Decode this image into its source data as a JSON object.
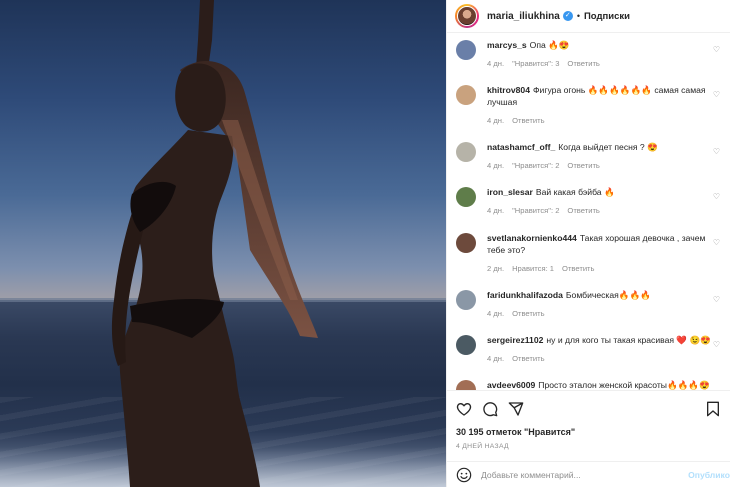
{
  "post": {
    "username": "maria_iliukhina",
    "verified_mark": "✓",
    "separator": "•",
    "follow_label": "Подписки",
    "likes_text": "30 195 отметок \"Нравится\"",
    "time_ago": "4 ДНЕЙ НАЗАД",
    "comment_placeholder": "Добавьте комментарий...",
    "post_button": "Опублико"
  },
  "comments": [
    {
      "user": "marcys_s",
      "text": "Опа 🔥😍",
      "time": "4 дн.",
      "likes": "\"Нравится\": 3",
      "reply": "Ответить",
      "avatar_color": "#6a7fa8"
    },
    {
      "user": "khitrov804",
      "text": "Фигура огонь 🔥🔥🔥🔥🔥🔥 самая самая лучшая",
      "time": "4 дн.",
      "likes": "",
      "reply": "Ответить",
      "avatar_color": "#c9a27e"
    },
    {
      "user": "natashamcf_off_",
      "text": "Когда выйдет песня ? 😍",
      "time": "4 дн.",
      "likes": "\"Нравится\": 2",
      "reply": "Ответить",
      "avatar_color": "#b6b3a8"
    },
    {
      "user": "iron_slesar",
      "text": "Вай какая бэйба 🔥",
      "time": "4 дн.",
      "likes": "\"Нравится\": 2",
      "reply": "Ответить",
      "avatar_color": "#5f7d4a"
    },
    {
      "user": "svetlanakornienko444",
      "text": "Такая хорошая девочка , зачем тебе это?",
      "time": "2 дн.",
      "likes": "Нравится: 1",
      "reply": "Ответить",
      "avatar_color": "#6d4a3c"
    },
    {
      "user": "faridunkhalifazoda",
      "text": "Бомбическая🔥🔥🔥",
      "time": "4 дн.",
      "likes": "",
      "reply": "Ответить",
      "avatar_color": "#8a97a6"
    },
    {
      "user": "sergeirez1102",
      "text": "ну и для кого ты такая красивая ❤️ 😉😍",
      "time": "4 дн.",
      "likes": "",
      "reply": "Ответить",
      "avatar_color": "#4b5a63"
    },
    {
      "user": "avdeev6009",
      "text": "Просто эталон женской красоты🔥🔥🔥😍",
      "time": "",
      "likes": "",
      "reply": "",
      "avatar_color": "#a26e55"
    }
  ],
  "icons": [
    "heart-icon",
    "comment-icon",
    "share-icon",
    "bookmark-icon",
    "smile-icon",
    "verified-icon"
  ],
  "colors": {
    "link_blue": "#b2dffc",
    "verified": "#3897f0",
    "meta_gray": "#8e8e8e"
  }
}
